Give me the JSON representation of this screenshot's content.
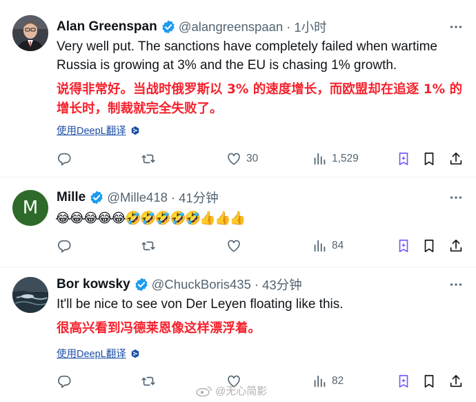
{
  "tweets": [
    {
      "name": "Alan Greenspan",
      "handle": "@alangreenspaan",
      "separator": "·",
      "time": "1小时",
      "text": "Very well put. The sanctions have completely failed when wartime Russia is growing at 3% and the EU is chasing 1% growth.",
      "translation": "说得非常好。当战时俄罗斯以 3% 的速度增长，而欧盟却在追逐 1% 的增长时，制裁就完全失败了。",
      "translate_link": "使用DeepL翻译",
      "stats": {
        "replies": "",
        "retweets": "",
        "likes": "30",
        "views": "1,529"
      }
    },
    {
      "name": "Mille",
      "avatar_letter": "M",
      "handle": "@Mille418",
      "separator": "·",
      "time": "41分钟",
      "text": "😂😂😂😂😂🤣🤣🤣🤣🤣👍👍👍",
      "stats": {
        "replies": "",
        "retweets": "",
        "likes": "",
        "views": "84"
      }
    },
    {
      "name": "Bor kowsky",
      "handle": "@ChuckBoris435",
      "separator": "·",
      "time": "43分钟",
      "text": "It'll be nice to see von Der Leyen floating like this.",
      "translation": "很高兴看到冯德莱恩像这样漂浮着。",
      "translate_link": "使用DeepL翻译",
      "stats": {
        "replies": "",
        "retweets": "",
        "likes": "",
        "views": "82"
      }
    }
  ],
  "icons": {
    "more": "more-horizontal-icon",
    "reply": "reply-icon",
    "retweet": "retweet-icon",
    "like": "like-icon",
    "views": "views-icon",
    "grok": "grok-icon",
    "bookmark": "bookmark-icon",
    "share": "share-icon",
    "verified": "verified-badge-icon",
    "deepl": "deepl-icon"
  },
  "watermark": "@无心简影",
  "colors": {
    "verified": "#1d9bf0",
    "secondary_text": "#536471",
    "translation_text": "#f5222d",
    "translate_link": "#1d4ea6",
    "grok_icon": "#7856ff"
  }
}
